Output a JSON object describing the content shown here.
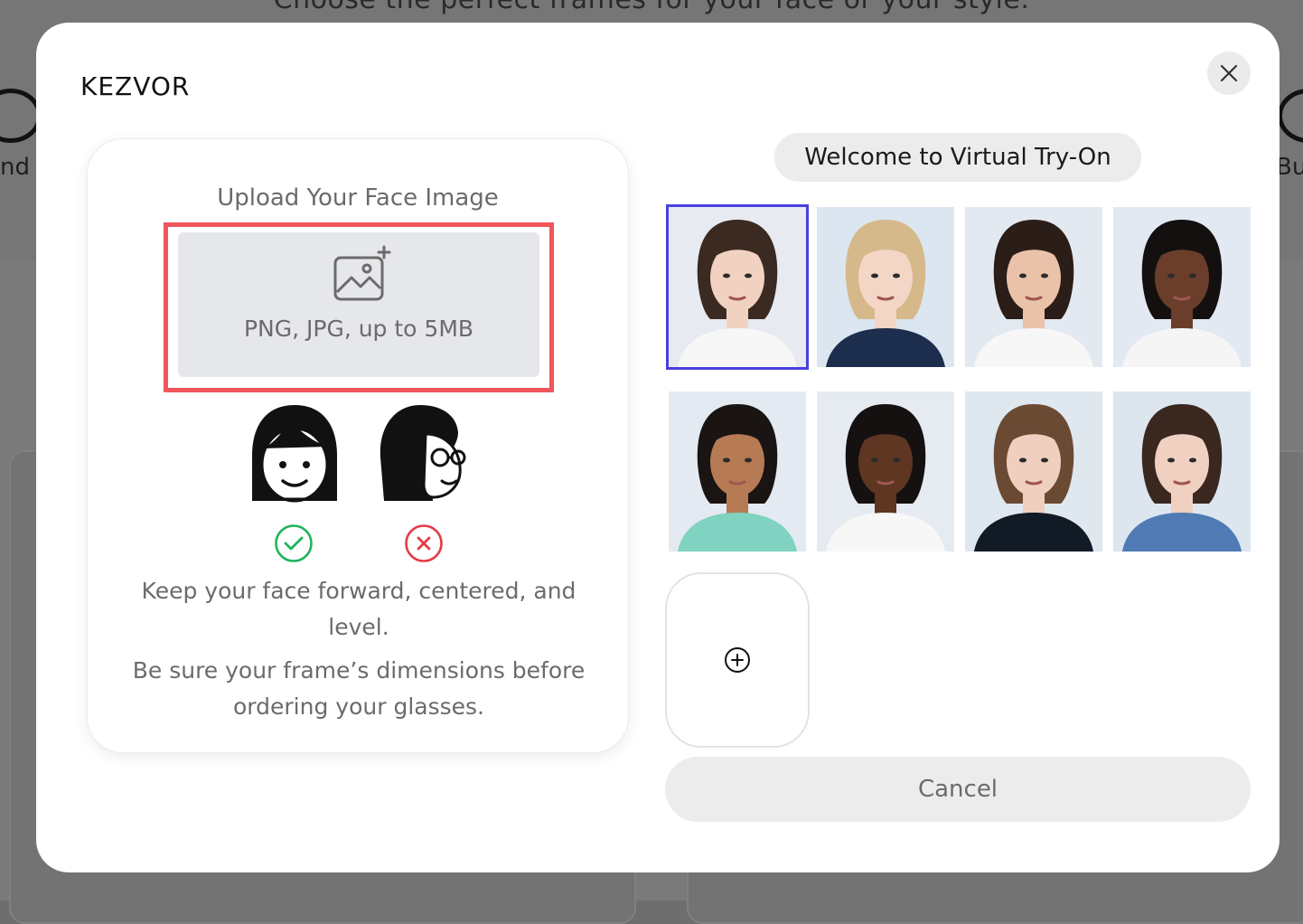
{
  "background": {
    "heading": "Choose the perfect frames for your face or your style.",
    "left_label": "nd",
    "right_label": "Bu"
  },
  "modal": {
    "brand": "KEZVOR",
    "close_icon": "close-icon",
    "upload": {
      "title": "Upload Your Face Image",
      "formats": "PNG, JPG, up to 5MB",
      "icon": "image-add-icon",
      "highlight_color": "#f0565b",
      "tips": [
        "Keep your face forward, centered, and level.",
        "Be sure your frame’s dimensions before ordering your glasses."
      ],
      "examples": [
        {
          "icon": "face-forward-icon",
          "status": "check-icon",
          "color": "#1fb45a"
        },
        {
          "icon": "face-turned-icon",
          "status": "x-icon",
          "color": "#e23b45"
        }
      ]
    },
    "gallery": {
      "welcome": "Welcome to Virtual Try-On",
      "selected_index": 0,
      "selected_color": "#4a3fe0",
      "models": [
        {
          "name": "model-1",
          "bg": "#e7ebf1",
          "skin": "#f1d2c1",
          "hair": "#3b2a22",
          "top": "#f7f7f7"
        },
        {
          "name": "model-2",
          "bg": "#dbe6f0",
          "skin": "#f3d6c6",
          "hair": "#d6b98a",
          "top": "#1c2d4e"
        },
        {
          "name": "model-3",
          "bg": "#e3e9f0",
          "skin": "#e9c2a9",
          "hair": "#2b1d17",
          "top": "#f7f7f7"
        },
        {
          "name": "model-4",
          "bg": "#e2e9f2",
          "skin": "#6a3e2a",
          "hair": "#141010",
          "top": "#f5f5f5"
        },
        {
          "name": "model-5",
          "bg": "#e4eaf2",
          "skin": "#b67a55",
          "hair": "#1a1412",
          "top": "#7fd3c0"
        },
        {
          "name": "model-6",
          "bg": "#e6ebf2",
          "skin": "#5e3622",
          "hair": "#151111",
          "top": "#f7f7f7"
        },
        {
          "name": "model-7",
          "bg": "#dfe7ef",
          "skin": "#efcfbd",
          "hair": "#6b4a34",
          "top": "#121a26"
        },
        {
          "name": "model-8",
          "bg": "#dde6ef",
          "skin": "#f0d0c0",
          "hair": "#3a2820",
          "top": "#4f7ab3"
        }
      ],
      "add_icon": "plus-circle-icon"
    },
    "cancel_label": "Cancel"
  }
}
